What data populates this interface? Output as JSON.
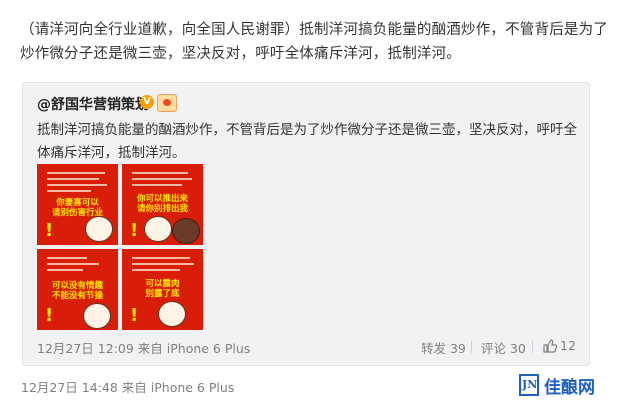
{
  "post": {
    "text": "（请洋河向全行业道歉，向全国人民谢罪）抵制洋河搞负能量的酗酒炒作，不管背后是为了炒作微分子还是微三壶，坚决反对，呼吁全体痛斥洋河，抵制洋河。",
    "timestamp": "12月27日 14:48",
    "source": "来自 iPhone 6 Plus"
  },
  "repost": {
    "author": "@舒国华营销策划",
    "verified_badge": "V",
    "text": "抵制洋河搞负能量的酗酒炒作，不管背后是为了炒作微分子还是微三壶，坚决反对，呼吁全体痛斥洋河，抵制洋河。",
    "images": [
      {
        "caption": "你妻喜可以\n请别伤害行业",
        "figure": "cartoon-face"
      },
      {
        "caption": "你可以推出来\n请你别排出我",
        "figure": "cartoon-pair"
      },
      {
        "caption": "可以没有情趣\n不能没有节操",
        "figure": "cartoon-face"
      },
      {
        "caption": "可以露肉\n别露了底",
        "figure": "cartoon-face"
      }
    ],
    "timestamp": "12月27日 12:09",
    "source": "来自 iPhone 6 Plus",
    "repost_label": "转发 39",
    "comment_label": "评论 30",
    "like_count": "12"
  },
  "watermark": {
    "brand": "佳酿网",
    "mark": "JN"
  },
  "colors": {
    "image_bg": "#d81e06",
    "image_text": "#ffe600",
    "brand_blue": "#1f5fbf",
    "meta_gray": "#808080"
  }
}
